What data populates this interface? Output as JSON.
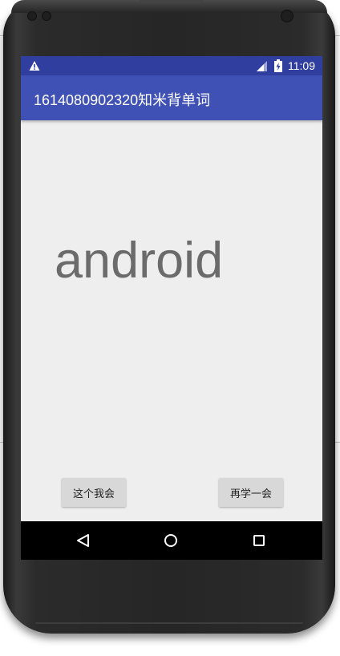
{
  "statusbar": {
    "time": "11:09",
    "warning_icon": "warning-icon",
    "signal_icon": "signal-icon",
    "battery_icon": "battery-icon"
  },
  "appbar": {
    "title": "1614080902320知米背单词"
  },
  "main": {
    "word": "android"
  },
  "buttons": {
    "know_label": "这个我会",
    "again_label": "再学一会"
  },
  "navbar": {
    "back_icon": "back-triangle-icon",
    "home_icon": "home-circle-icon",
    "recents_icon": "recents-square-icon"
  },
  "colors": {
    "statusbar": "#303f9f",
    "appbar": "#3f51b5",
    "background": "#eeeeee",
    "word_text": "#6b6b6b",
    "button": "#d8d8d8"
  }
}
